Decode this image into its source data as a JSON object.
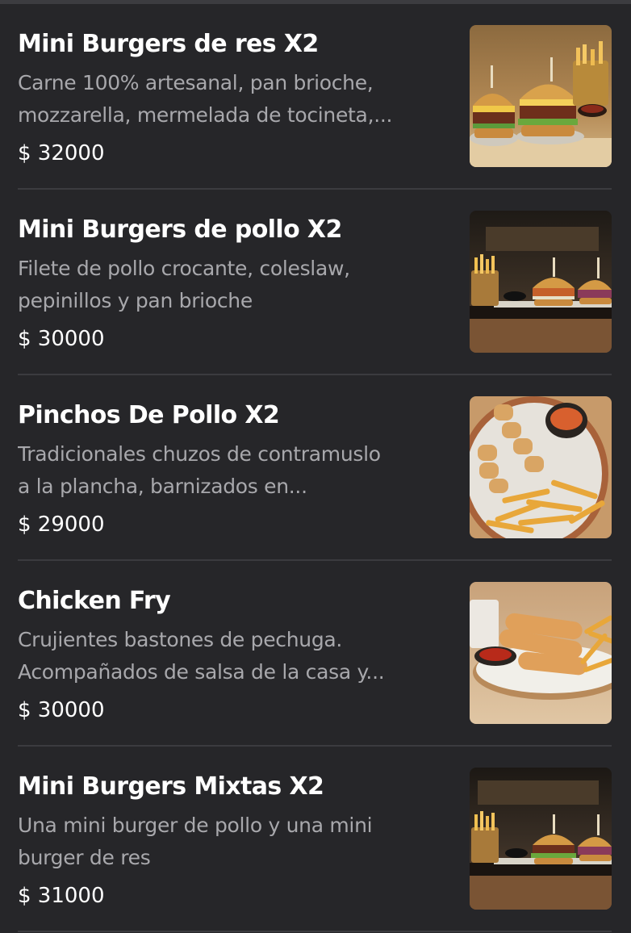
{
  "menu": {
    "items": [
      {
        "title": "Mini Burgers de res X2",
        "description": "Carne 100% artesanal, pan brioche,\nmozzarella, mermelada de tocineta,...",
        "price": "$ 32000",
        "image_icon": "mini-beef-burgers-photo"
      },
      {
        "title": "Mini Burgers de pollo X2",
        "description": "Filete de pollo crocante, coleslaw,\npepinillos y pan brioche",
        "price": "$ 30000",
        "image_icon": "mini-chicken-burgers-photo"
      },
      {
        "title": "Pinchos De Pollo X2",
        "description": "Tradicionales chuzos de contramuslo\na la plancha, barnizados en...",
        "price": "$ 29000",
        "image_icon": "chicken-skewers-photo"
      },
      {
        "title": "Chicken Fry",
        "description": "Crujientes bastones de pechuga.\nAcompañados de salsa de la casa y...",
        "price": "$ 30000",
        "image_icon": "chicken-fingers-photo"
      },
      {
        "title": "Mini Burgers Mixtas X2",
        "description": "Una mini burger de pollo y una mini\nburger de res",
        "price": "$ 31000",
        "image_icon": "mixed-mini-burgers-photo"
      }
    ]
  }
}
